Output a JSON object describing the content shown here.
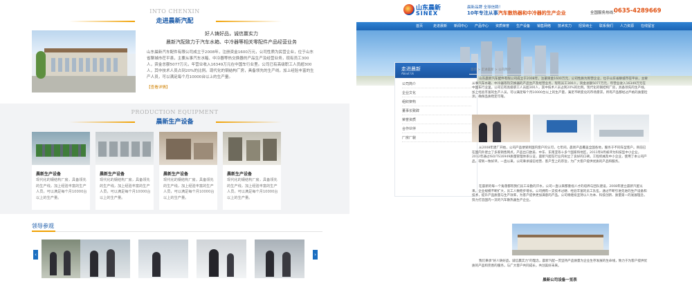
{
  "left": {
    "about": {
      "sub": "INTO CHENXIN",
      "title": "走进晨新汽配",
      "slogan1": "好人铸好品，诚信赢实力",
      "slogan2": "晨新汽配致力于汽车水箱、中冷器等相关零配件产品经营业务",
      "body": "山东晨新汽车配件有限公司成立于2008年，注册资金1600万元，公司性质为民营企业，位于山东省聊城市茌平县，主要从事汽车水箱、中冷器等热交换器的产品生产及经营业务，现有员工300人，资金总额5077万元，年营业收入16349万元在中国车行业里。公司已有高级职工人员超300人，其中技术人员占到20%的比例。现代化的钢结构厂房，具备领先的生产线，加上经验丰富的生产人员，可以满足每个月10000台以上的生产量。",
      "more": "【查看详情】"
    },
    "equipment": {
      "sub": "PRODUCTION EQUIPMENT",
      "title": "晨新生产设备",
      "cards": [
        {
          "name": "晨新生产设备",
          "desc": "现代化的钢结构厂房，具备领先的生产线，加上经验丰富的生产人员，可以满足每个月10000台以上的生产量。"
        },
        {
          "name": "晨新生产设备",
          "desc": "现代化的钢结构厂房，具备领先的生产线，加上经验丰富的生产人员，可以满足每个月10000台以上的生产量。"
        },
        {
          "name": "晨新生产设备",
          "desc": "现代化的钢结构厂房，具备领先的生产线，加上经验丰富的生产人员，可以满足每个月10000台以上的生产量。"
        },
        {
          "name": "晨新生产设备",
          "desc": "现代化的钢结构厂房，具备领先的生产线，加上经验丰富的生产人员，可以满足每个月10000台以上的生产量。"
        }
      ]
    },
    "visit": {
      "title": "领导参观",
      "prev": "‹",
      "next": "›"
    }
  },
  "right": {
    "logo": {
      "cn": "山东晨新",
      "en": "SINEX"
    },
    "slogan_top": "晨新品牌 全球信赖！",
    "slogan_main_a": "10年专注从事",
    "slogan_main_b": "汽车散热器和中冷器的生产企业",
    "hotline_label": "全国服务热线：",
    "hotline": "0635-4289669",
    "nav": [
      "首页",
      "走进晨新",
      "新闻中心",
      "产品中心",
      "资质荣誉",
      "生产设备",
      "销售网络",
      "技术实力",
      "招贤纳士",
      "联系我们",
      "人力资源",
      "在线留言"
    ],
    "sidebar": {
      "title": "走进晨新",
      "sub": "About Us",
      "items": [
        "公司简介",
        "企业文化",
        "组织架构",
        "董事长致辞",
        "荣誉资质",
        "合作伙伴",
        "厂房厂貌"
      ]
    },
    "breadcrumb": "首页 > 走进晨新 > 公司简介",
    "para1": "山东晨新汽车配件有限公司成立于2008年，注册资金1600万元，公司性质为民营企业，位于山东省聊城市茌平县，主要从事汽车水箱、中冷器等热交换器的产品生产及经营业务，现有员工300人，资金总额5077万元，年营业收入16349万元在中国车行业里。公司已有高级职工人员超300人，其中技术人员占到20%的比例。现代化的钢结构厂房，具备领先的生产线，加上经验丰富的生产人员，可以满足每个月10000台以上的生产量，满足不断变化的市场需求。所有产品都经过严格的质量检测，确保品质稳定可靠。",
    "para2": "从2008年建厂开始，公司产品便受到国内客户的认可，七年间，晨新产品覆盖全国各地，服务于不同车型客户。目前已在国内外建立了多家销售网点，产品出口欧美、中东、东南亚等十多个国家和地区，2011年8月被评为科技型中小企业，2012年通过ISO/TS16949质量管理体系认证，晨新汽配在行业内树立了良好的口碑。工程机械及中小企业，使用了本公司产品，得到一致好评。一直以来，公司秉承诚信经营、客户至上的宗旨，为广大客户提供优质的产品和服务。",
    "para3": "在晨新的每一个角落都有我们员工辛勤的汗水，公司一直以来都重视人才的培养与团队建设，2008年建立晨新汽配以来，企业规模不断扩大，员工人数稳步增长。公司拥有一支技术过硬、经验丰富的员工队伍，通过不断引进先进的生产设备和技术，提升产品质量与生产效率，为客户提供更加满意的产品。公司将继续坚持以人为本、科技创新、质量第一的发展理念，努力打造国内一流的汽车散热器生产企业。",
    "para4": "我们秉承\"好人铸好品，诚信赢实力\"的理念，晨新汽配一贯坚持产品质量为企业生存发展的生命线，致力于为客户提供优质的产品和完善的服务，与广大客户共同成长，共创美好未来。",
    "caption": "晨新公司设备一览表"
  }
}
